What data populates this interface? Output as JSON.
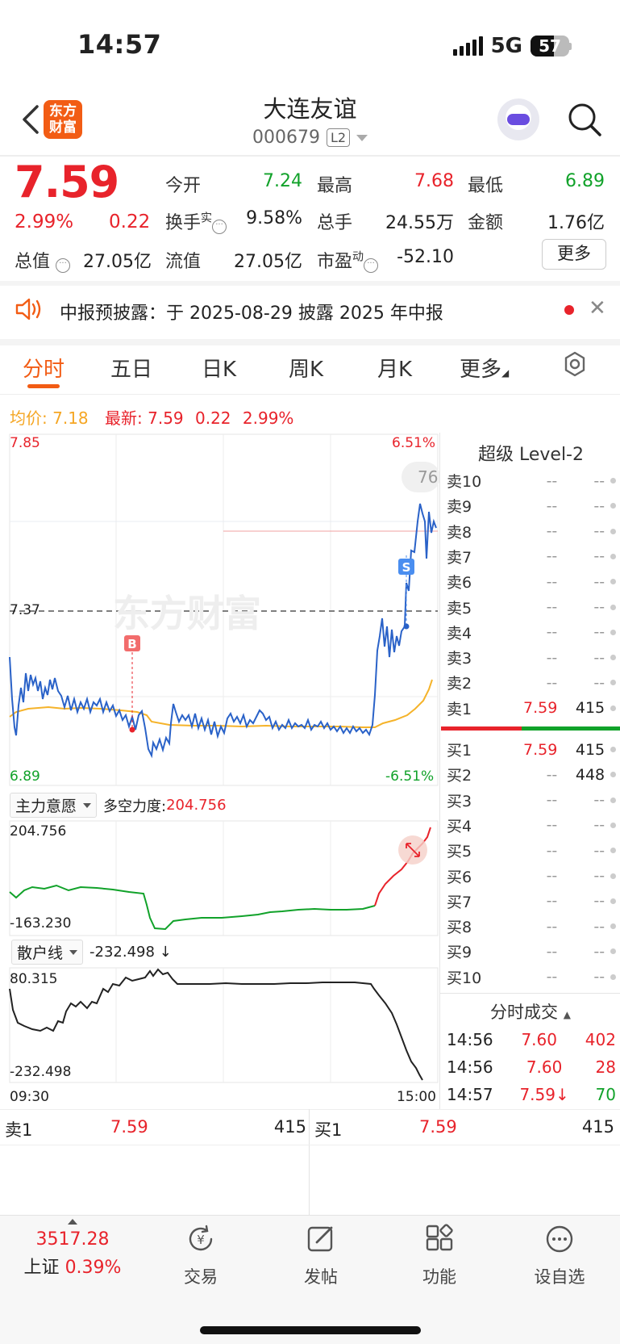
{
  "status_bar": {
    "time": "14:57",
    "network": "5G",
    "battery": "57"
  },
  "header": {
    "logo_text": "东方财富",
    "stock_name": "大连友谊",
    "stock_code": "000679",
    "level_badge": "L2"
  },
  "quote": {
    "price": "7.59",
    "change_pct": "2.99%",
    "change_amt": "0.22",
    "open_label": "今开",
    "open": "7.24",
    "high_label": "最高",
    "high": "7.68",
    "low_label": "最低",
    "low": "6.89",
    "turnover_label": "换手",
    "turnover_sup": "实",
    "turnover": "9.58%",
    "volume_label": "总手",
    "volume": "24.55万",
    "amount_label": "金额",
    "amount": "1.76亿",
    "mktcap_label": "总值",
    "mktcap": "27.05亿",
    "float_label": "流值",
    "float_cap": "27.05亿",
    "pe_label": "市盈",
    "pe_sup": "动",
    "pe": "-52.10",
    "more_label": "更多"
  },
  "notice": {
    "text": "中报预披露：于 2025-08-29 披露 2025 年中报"
  },
  "tabs": [
    "分时",
    "五日",
    "日K",
    "周K",
    "月K",
    "更多"
  ],
  "intraday": {
    "avg_label": "均价:",
    "avg_value": "7.18",
    "latest_label": "最新:",
    "latest_value": "7.59",
    "latest_chg": "0.22",
    "latest_pct": "2.99%",
    "y_top": "7.85",
    "y_mid": "7.37",
    "y_bottom": "6.89",
    "pct_top": "6.51%",
    "pct_bottom": "-6.51%",
    "bubble": "76",
    "watermark": "东方财富",
    "buy_marker": "B",
    "sell_marker": "S",
    "colors": {
      "price_line": "#2a62c8",
      "avg_line": "#f5b32a",
      "up": "#e8232b",
      "down": "#11a22a"
    }
  },
  "indicator1": {
    "name": "主力意愿",
    "metric_label": "多空力度:",
    "metric_value": "204.756",
    "top": "204.756",
    "bottom": "-163.230"
  },
  "indicator2": {
    "name": "散户线",
    "metric_value": "-232.498 ↓",
    "top": "80.315",
    "bottom": "-232.498",
    "time_start": "09:30",
    "time_end": "15:00"
  },
  "level2": {
    "title": "超级 Level-2",
    "asks": [
      {
        "label": "卖10",
        "price": "--",
        "vol": "--"
      },
      {
        "label": "卖9",
        "price": "--",
        "vol": "--"
      },
      {
        "label": "卖8",
        "price": "--",
        "vol": "--"
      },
      {
        "label": "卖7",
        "price": "--",
        "vol": "--"
      },
      {
        "label": "卖6",
        "price": "--",
        "vol": "--"
      },
      {
        "label": "卖5",
        "price": "--",
        "vol": "--"
      },
      {
        "label": "卖4",
        "price": "--",
        "vol": "--"
      },
      {
        "label": "卖3",
        "price": "--",
        "vol": "--"
      },
      {
        "label": "卖2",
        "price": "--",
        "vol": "--"
      },
      {
        "label": "卖1",
        "price": "7.59",
        "vol": "415"
      }
    ],
    "bids": [
      {
        "label": "买1",
        "price": "7.59",
        "vol": "415"
      },
      {
        "label": "买2",
        "price": "--",
        "vol": "448"
      },
      {
        "label": "买3",
        "price": "--",
        "vol": "--"
      },
      {
        "label": "买4",
        "price": "--",
        "vol": "--"
      },
      {
        "label": "买5",
        "price": "--",
        "vol": "--"
      },
      {
        "label": "买6",
        "price": "--",
        "vol": "--"
      },
      {
        "label": "买7",
        "price": "--",
        "vol": "--"
      },
      {
        "label": "买8",
        "price": "--",
        "vol": "--"
      },
      {
        "label": "买9",
        "price": "--",
        "vol": "--"
      },
      {
        "label": "买10",
        "price": "--",
        "vol": "--"
      }
    ],
    "trades_title": "分时成交",
    "trades": [
      {
        "time": "14:56",
        "price": "7.60",
        "vol": "402"
      },
      {
        "time": "14:56",
        "price": "7.60",
        "vol": "28"
      },
      {
        "time": "14:57",
        "price": "7.59↓",
        "vol": "70"
      }
    ]
  },
  "bottom_quote": {
    "ask_label": "卖1",
    "ask_price": "7.59",
    "ask_vol": "415",
    "bid_label": "买1",
    "bid_price": "7.59",
    "bid_vol": "415"
  },
  "bottom_nav": {
    "index_value": "3517.28",
    "index_name": "上证",
    "index_pct": "0.39%",
    "items": [
      "交易",
      "发帖",
      "功能",
      "设自选"
    ]
  }
}
